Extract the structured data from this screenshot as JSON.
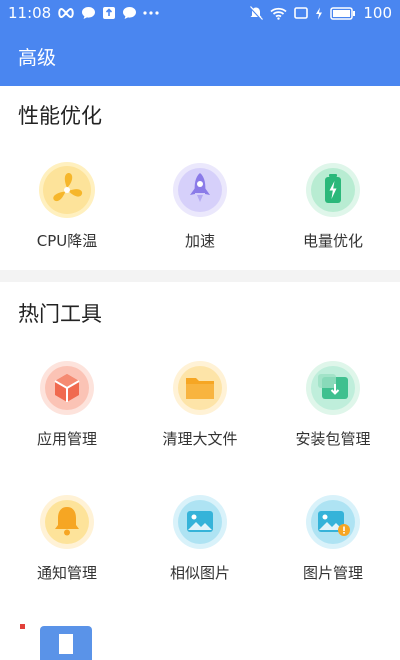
{
  "status": {
    "time": "11:08",
    "battery": "100",
    "left_icons": [
      "infinity-icon",
      "chat-bubble-icon",
      "upload-box-icon",
      "chat-bubble-icon",
      "more-dots-icon"
    ],
    "right_icons": [
      "mute-bell-icon",
      "wifi-icon",
      "screen-icon",
      "charging-icon",
      "battery-icon"
    ]
  },
  "appbar": {
    "title": "高级"
  },
  "sections": [
    {
      "title": "性能优化",
      "items": [
        {
          "label": "CPU降温",
          "icon": "fan-icon",
          "color": "#f6b62a"
        },
        {
          "label": "加速",
          "icon": "rocket-icon",
          "color": "#8b7be8"
        },
        {
          "label": "电量优化",
          "icon": "battery-icon",
          "color": "#2bb87a"
        }
      ]
    },
    {
      "title": "热门工具",
      "items": [
        {
          "label": "应用管理",
          "icon": "cube-icon",
          "color": "#f06a4f"
        },
        {
          "label": "清理大文件",
          "icon": "folder-icon",
          "color": "#f6a623"
        },
        {
          "label": "安装包管理",
          "icon": "package-icon",
          "color": "#3fc08f"
        },
        {
          "label": "通知管理",
          "icon": "bell-icon",
          "color": "#f6a623"
        },
        {
          "label": "相似图片",
          "icon": "image-icon",
          "color": "#35b3d9"
        },
        {
          "label": "图片管理",
          "icon": "image-warning-icon",
          "color": "#35b3d9"
        }
      ]
    }
  ]
}
